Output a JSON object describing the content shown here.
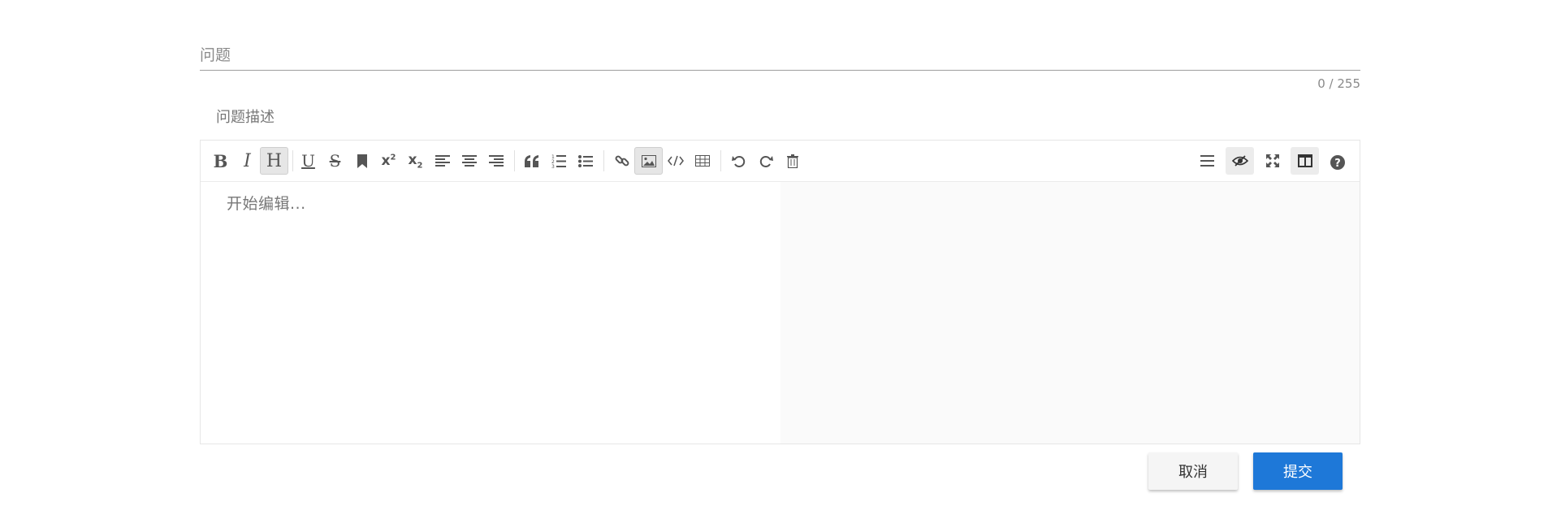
{
  "title_field": {
    "placeholder": "问题",
    "value": ""
  },
  "char_counter": "0 / 255",
  "description_label": "问题描述",
  "editor": {
    "placeholder": "开始编辑...",
    "toolbar_left": [
      {
        "icon": "bold-icon",
        "glyph": "B"
      },
      {
        "icon": "italic-icon",
        "glyph": "I"
      },
      {
        "icon": "header-icon",
        "glyph": "H",
        "active": true
      },
      {
        "icon": "underline-icon",
        "glyph": "U"
      },
      {
        "icon": "strikethrough-icon",
        "glyph": "S"
      },
      {
        "icon": "mark-icon"
      },
      {
        "icon": "superscript-icon",
        "glyph": "x²"
      },
      {
        "icon": "subscript-icon",
        "glyph": "x₂"
      },
      {
        "icon": "align-left-icon"
      },
      {
        "icon": "align-center-icon"
      },
      {
        "icon": "align-right-icon"
      },
      {
        "icon": "quote-icon"
      },
      {
        "icon": "ordered-list-icon"
      },
      {
        "icon": "unordered-list-icon"
      },
      {
        "icon": "link-icon"
      },
      {
        "icon": "image-icon",
        "active": true
      },
      {
        "icon": "code-icon"
      },
      {
        "icon": "table-icon"
      },
      {
        "icon": "undo-icon"
      },
      {
        "icon": "redo-icon"
      },
      {
        "icon": "trash-icon"
      }
    ],
    "toolbar_right": [
      {
        "icon": "navigation-icon"
      },
      {
        "icon": "preview-toggle-icon",
        "active": true
      },
      {
        "icon": "fullscreen-icon"
      },
      {
        "icon": "subfield-icon",
        "active": true
      },
      {
        "icon": "help-icon"
      }
    ]
  },
  "buttons": {
    "cancel": "取消",
    "submit": "提交"
  }
}
